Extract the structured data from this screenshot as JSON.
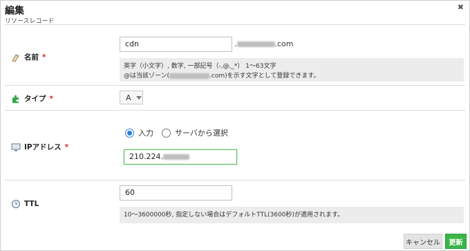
{
  "dialog": {
    "title": "編集",
    "subtitle": "リソースレコード",
    "close_glyph": "✖"
  },
  "name_field": {
    "label": "名前",
    "required_mark": "*",
    "value": "cdn",
    "suffix_prefix": ".",
    "suffix_end": ".com",
    "help_line1": "英字（小文字）, 数字, 一部記号（-,@,_*） 1〜63文字",
    "help_line2_start": "@は当該ゾーン(",
    "help_line2_end": ".com)を示す文字として登録できます。"
  },
  "type_field": {
    "label": "タイプ",
    "required_mark": "*",
    "selected": "A"
  },
  "ip_field": {
    "label": "IPアドレス",
    "required_mark": "*",
    "radio_input": "入力",
    "radio_server": "サーバから選択",
    "value_visible": "210.224."
  },
  "ttl_field": {
    "label": "TTL",
    "value": "60",
    "help": "10〜3600000秒, 指定しない場合はデフォルトTTL(3600秒)が適用されます。"
  },
  "buttons": {
    "cancel": "キャンセル",
    "update": "更新"
  },
  "colors": {
    "accent_blue": "#2a7fd4",
    "update_green": "#3cb548",
    "required_red": "#dd2222",
    "focus_green": "#5cb85c"
  }
}
